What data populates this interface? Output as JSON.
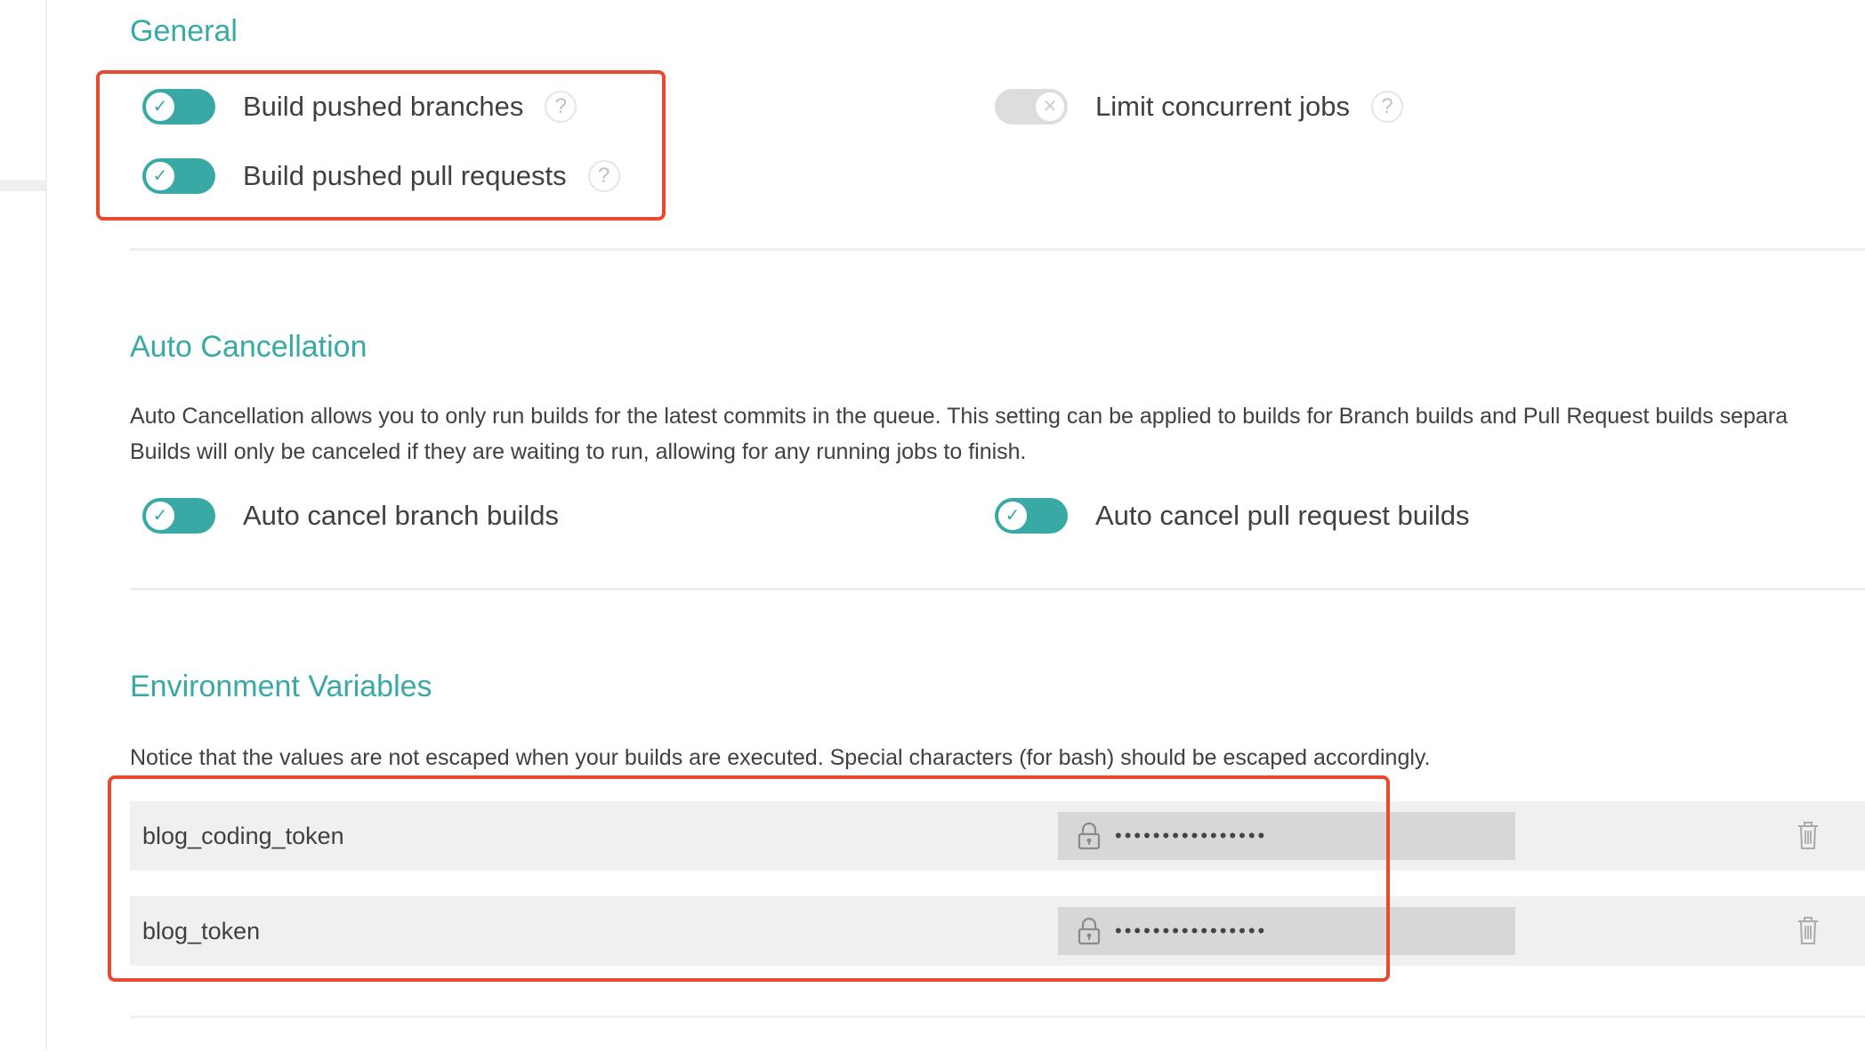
{
  "sections": {
    "general": {
      "title": "General",
      "settings": [
        {
          "label": "Build pushed branches",
          "enabled": true,
          "has_help": true
        },
        {
          "label": "Build pushed pull requests",
          "enabled": true,
          "has_help": true
        },
        {
          "label": "Limit concurrent jobs",
          "enabled": false,
          "has_help": true
        }
      ]
    },
    "auto_cancellation": {
      "title": "Auto Cancellation",
      "description_line1": "Auto Cancellation allows you to only run builds for the latest commits in the queue. This setting can be applied to builds for Branch builds and Pull Request builds separa",
      "description_line2": "Builds will only be canceled if they are waiting to run, allowing for any running jobs to finish.",
      "settings": [
        {
          "label": "Auto cancel branch builds",
          "enabled": true
        },
        {
          "label": "Auto cancel pull request builds",
          "enabled": true
        }
      ]
    },
    "environment_variables": {
      "title": "Environment Variables",
      "notice": "Notice that the values are not escaped when your builds are executed. Special characters (for bash) should be escaped accordingly.",
      "variables": [
        {
          "name": "blog_coding_token",
          "value_masked": "••••••••••••••••"
        },
        {
          "name": "blog_token",
          "value_masked": "••••••••••••••••"
        }
      ]
    }
  },
  "icons": {
    "toggle_on": "check-icon",
    "toggle_off": "x-icon",
    "help": "question-icon",
    "lock": "lock-icon",
    "delete": "trash-icon"
  },
  "glyphs": {
    "check": "✓",
    "x": "✕",
    "help": "?"
  },
  "colors": {
    "accent": "#39a9a6",
    "toggle_off": "#dddddd",
    "highlight": "#e94a2d",
    "row_bg": "#f0f0f0",
    "value_bg": "#d7d7d7"
  }
}
